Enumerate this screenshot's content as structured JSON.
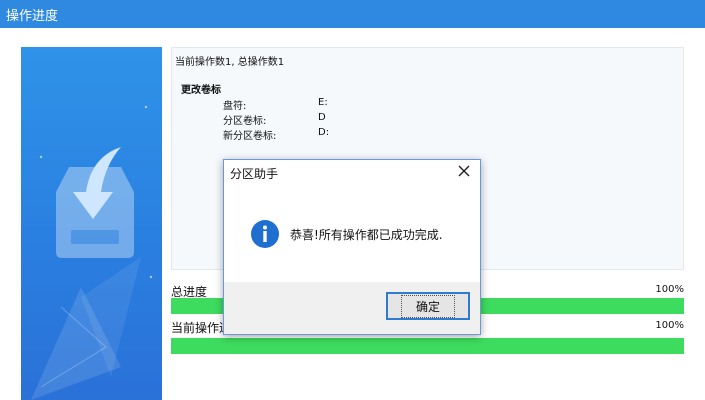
{
  "window": {
    "title": "操作进度"
  },
  "log": {
    "summary": "当前操作数1, 总操作数1",
    "section_title": "更改卷标",
    "rows": [
      {
        "label": "盘符:",
        "value": "E:"
      },
      {
        "label": "分区卷标:",
        "value": "D"
      },
      {
        "label": "新分区卷标:",
        "value": "D:"
      }
    ]
  },
  "progress": {
    "total_label": "总进度",
    "total_percent": "100%",
    "total_value": 1.0,
    "current_label": "当前操作进",
    "current_percent": "100%",
    "current_value": 1.0
  },
  "dialog": {
    "title": "分区助手",
    "message": "恭喜!所有操作都已成功完成.",
    "ok_label": "确定"
  },
  "colors": {
    "titlebar": "#2f89e0",
    "progress_fill": "#3ddb5e",
    "info_icon": "#1f6fd1"
  },
  "icons": {
    "close": "close-icon",
    "info": "info-icon",
    "download": "download-tray-icon"
  }
}
